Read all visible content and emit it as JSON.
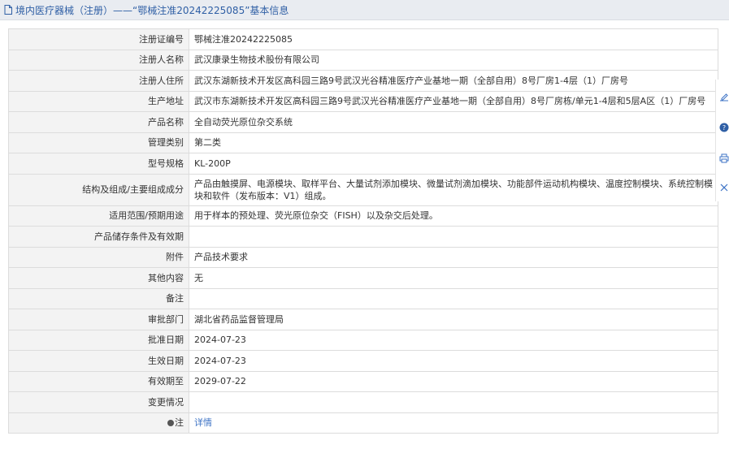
{
  "header": {
    "title": "境内医疗器械（注册）——“鄂械注准20242225085”基本信息"
  },
  "rows": [
    {
      "label": "注册证编号",
      "value": "鄂械注准20242225085"
    },
    {
      "label": "注册人名称",
      "value": "武汉康录生物技术股份有限公司"
    },
    {
      "label": "注册人住所",
      "value": "武汉东湖新技术开发区高科园三路9号武汉光谷精准医疗产业基地一期（全部自用）8号厂房1-4层（1）厂房号"
    },
    {
      "label": "生产地址",
      "value": "武汉市东湖新技术开发区高科园三路9号武汉光谷精准医疗产业基地一期（全部自用）8号厂房栋/单元1-4层和5层A区（1）厂房号"
    },
    {
      "label": "产品名称",
      "value": "全自动荧光原位杂交系统"
    },
    {
      "label": "管理类别",
      "value": "第二类"
    },
    {
      "label": "型号规格",
      "value": "KL-200P"
    },
    {
      "label": "结构及组成/主要组成成分",
      "value": "产品由触摸屏、电源模块、取样平台、大量试剂添加模块、微量试剂滴加模块、功能部件运动机构模块、温度控制模块、系统控制模块和软件（发布版本：V1）组成。"
    },
    {
      "label": "适用范围/预期用途",
      "value": "用于样本的预处理、荧光原位杂交（FISH）以及杂交后处理。"
    },
    {
      "label": "产品储存条件及有效期",
      "value": ""
    },
    {
      "label": "附件",
      "value": "产品技术要求"
    },
    {
      "label": "其他内容",
      "value": "无"
    },
    {
      "label": "备注",
      "value": ""
    },
    {
      "label": "审批部门",
      "value": "湖北省药品监督管理局"
    },
    {
      "label": "批准日期",
      "value": "2024-07-23"
    },
    {
      "label": "生效日期",
      "value": "2024-07-23"
    },
    {
      "label": "有效期至",
      "value": "2029-07-22"
    },
    {
      "label": "变更情况",
      "value": ""
    }
  ],
  "note_row": {
    "label": "注",
    "link": "详情"
  },
  "colors": {
    "header_bg": "#e9ecf1",
    "title": "#2f5fa5",
    "link": "#3d73c5",
    "label_bg": "#f3f3f3"
  }
}
